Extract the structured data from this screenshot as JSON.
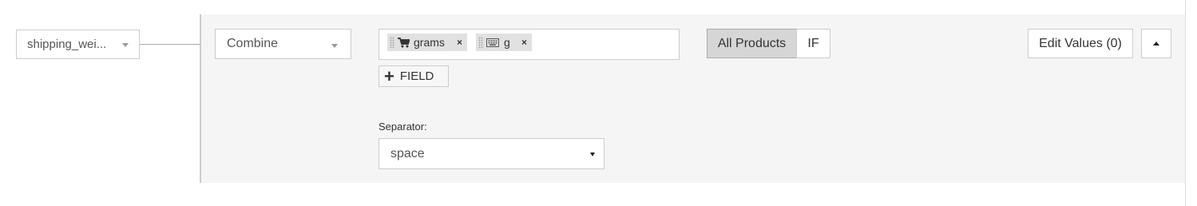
{
  "field_select": {
    "value": "shipping_wei...",
    "icon": "caret-down-icon"
  },
  "combine_select": {
    "value": "Combine",
    "icon": "caret-down-icon"
  },
  "fields": [
    {
      "label": "grams",
      "icon": "cart-icon",
      "remove": "×"
    },
    {
      "label": "g",
      "icon": "keyboard-icon",
      "remove": "×"
    }
  ],
  "add_field_button": {
    "icon": "plus-icon",
    "label": "FIELD"
  },
  "separator": {
    "label": "Separator:",
    "value": "space"
  },
  "scope_toggle": {
    "all_products": "All Products",
    "if": "IF",
    "selected": "All Products"
  },
  "edit_values_button": "Edit Values (0)",
  "collapse_button": {
    "icon": "caret-up-icon"
  },
  "colors": {
    "panel_bg": "#f5f5f5",
    "selected_segment": "#d6d6d6",
    "tag_bg": "#e1e1e1"
  }
}
